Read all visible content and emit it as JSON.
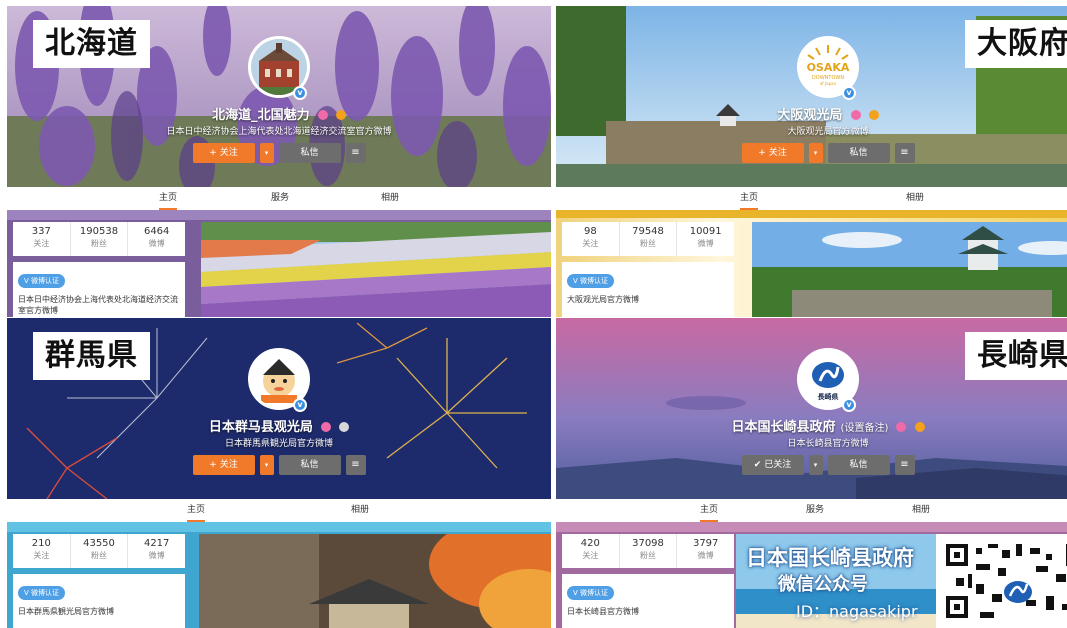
{
  "panels": [
    {
      "region": "北海道",
      "nickname": "北海道_北国魅力",
      "remark": "",
      "description": "日本日中经济协会上海代表处北海道经济交流室官方微博",
      "follow_label": "+ 关注",
      "message_label": "私信",
      "more_label": "≡",
      "tabs": [
        "主页",
        "服务",
        "相册"
      ],
      "stats": [
        {
          "value": "337",
          "label": "关注"
        },
        {
          "value": "190538",
          "label": "粉丝"
        },
        {
          "value": "6464",
          "label": "微博"
        }
      ],
      "verify_tag": "V 微博认证",
      "verify_text": "日本日中经济协会上海代表处北海道经济交流室官方微博"
    },
    {
      "region": "大阪府",
      "logo_line1": "OSAKA",
      "logo_line2": "DOWNTOWN",
      "logo_line3": "of Japan",
      "nickname": "大阪观光局",
      "remark": "",
      "description": "大阪观光局官方微博",
      "follow_label": "+ 关注",
      "message_label": "私信",
      "more_label": "≡",
      "tabs": [
        "主页",
        "相册"
      ],
      "stats": [
        {
          "value": "98",
          "label": "关注"
        },
        {
          "value": "79548",
          "label": "粉丝"
        },
        {
          "value": "10091",
          "label": "微博"
        }
      ],
      "verify_tag": "V 微博认证",
      "verify_text": "大阪观光局官方微博"
    },
    {
      "region": "群馬県",
      "nickname": "日本群马县观光局",
      "remark": "",
      "description": "日本群馬県観光局官方微博",
      "follow_label": "+ 关注",
      "message_label": "私信",
      "more_label": "≡",
      "tabs": [
        "主页",
        "相册"
      ],
      "stats": [
        {
          "value": "210",
          "label": "关注"
        },
        {
          "value": "43550",
          "label": "粉丝"
        },
        {
          "value": "4217",
          "label": "微博"
        }
      ],
      "verify_tag": "V 微博认证",
      "verify_text": "日本群馬県観光局官方微博"
    },
    {
      "region": "長崎県",
      "logo_text": "長崎県",
      "nickname": "日本国长崎县政府",
      "remark": "(设置备注)",
      "description": "日本长崎县官方微博",
      "follow_label": "✔ 已关注",
      "message_label": "私信",
      "more_label": "≡",
      "tabs": [
        "主页",
        "服务",
        "相册"
      ],
      "stats": [
        {
          "value": "420",
          "label": "关注"
        },
        {
          "value": "37098",
          "label": "粉丝"
        },
        {
          "value": "3797",
          "label": "微博"
        }
      ],
      "verify_tag": "V 微博认证",
      "verify_text": "日本长崎县官方微博",
      "wechat_title": "日本国长崎县政府",
      "wechat_sub": "微信公众号",
      "wechat_id": "ID：nagasakipr"
    }
  ],
  "icons": {
    "dropdown": "▾",
    "verified": "v"
  },
  "colors": {
    "follow": "#f07a2a",
    "neutral_button": "#6d6d6d",
    "verify_tag": "#4e9fe5"
  }
}
